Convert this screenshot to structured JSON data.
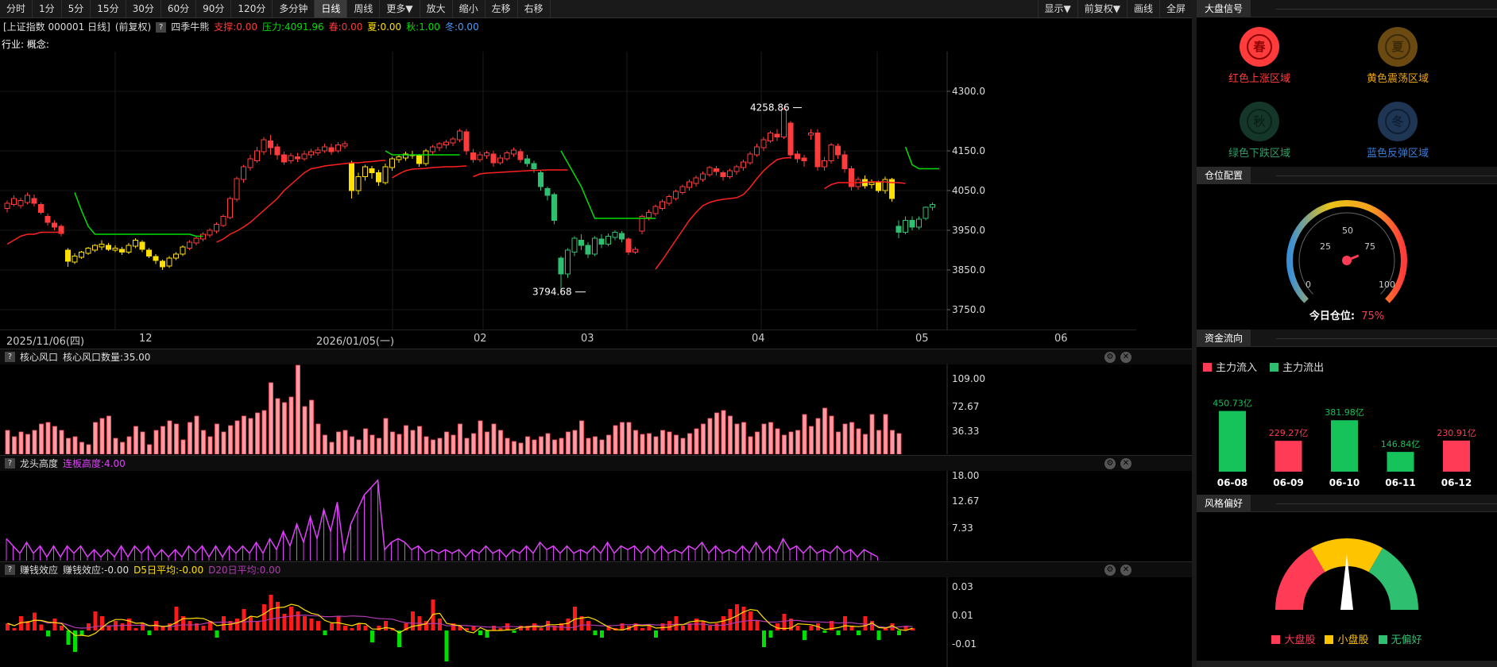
{
  "toolbar": {
    "left": [
      "分时",
      "1分",
      "5分",
      "15分",
      "30分",
      "60分",
      "90分",
      "120分",
      "多分钟",
      "日线",
      "周线",
      "更多▼",
      "放大",
      "缩小",
      "左移",
      "右移"
    ],
    "active_index": 9,
    "right": [
      "显示▼",
      "前复权▼",
      "画线",
      "全屏"
    ]
  },
  "main_info": {
    "index_name": "[上证指数 000001 日线]",
    "adjust": "(前复权)",
    "indicator": "四季牛熊",
    "support": "支撑:0.00",
    "pressure": "压力:4091.96",
    "spring": "春:0.00",
    "summer": "夏:0.00",
    "autumn": "秋:1.00",
    "winter": "冬:0.00",
    "industry": "行业: 概念:",
    "colors": {
      "support": "#ff3b3b",
      "pressure": "#00e000",
      "spring": "#ff3b3b",
      "summer": "#ffe000",
      "autumn": "#00e000",
      "winter": "#4a9cff"
    }
  },
  "main_chart": {
    "y_ticks": [
      "4300.0",
      "4150.0",
      "4050.0",
      "3950.0",
      "3850.0",
      "3750.0"
    ],
    "high_label": "4258.86",
    "low_label": "3794.68"
  },
  "date_axis": [
    "2025/11/06(四)",
    "12",
    "2026/01/05(一)",
    "02",
    "03",
    "04",
    "05",
    "06"
  ],
  "panel1": {
    "name": "核心风口",
    "value": "核心风口数量:35.00",
    "y_ticks": [
      "109.00",
      "72.67",
      "36.33"
    ]
  },
  "panel2": {
    "name": "龙头高度",
    "value": "连板高度:4.00",
    "y_ticks": [
      "18.00",
      "12.67",
      "7.33"
    ]
  },
  "panel3": {
    "name": "赚钱效应",
    "value": "赚钱效应:-0.00",
    "d5": "D5日平均:-0.00",
    "d20": "D20日平均:0.00",
    "y_ticks": [
      "0.03",
      "0.01",
      "-0.01"
    ]
  },
  "right": {
    "market_signal": {
      "title": "大盘信号",
      "seasons": [
        {
          "glyph": "春",
          "label": "红色上涨区域",
          "color": "#ff3b3b",
          "active": true
        },
        {
          "glyph": "夏",
          "label": "黄色震荡区域",
          "color": "#e8a317",
          "active": false
        },
        {
          "glyph": "秋",
          "label": "绿色下跌区域",
          "color": "#2f9c67",
          "active": false
        },
        {
          "glyph": "冬",
          "label": "蓝色反弹区域",
          "color": "#3a7bd5",
          "active": false
        }
      ]
    },
    "position": {
      "title": "仓位配置",
      "ticks": [
        "0",
        "25",
        "50",
        "75",
        "100"
      ],
      "label": "今日仓位:",
      "value": "75%",
      "level": 0.75
    },
    "capital_flow": {
      "title": "资金流向",
      "legend_in": "主力流入",
      "legend_out": "主力流出",
      "bars": [
        {
          "date": "06-08",
          "value": 450.73,
          "label": "450.73亿",
          "dir": "out"
        },
        {
          "date": "06-09",
          "value": 229.27,
          "label": "229.27亿",
          "dir": "in"
        },
        {
          "date": "06-10",
          "value": 381.98,
          "label": "381.98亿",
          "dir": "out"
        },
        {
          "date": "06-11",
          "value": 146.84,
          "label": "146.84亿",
          "dir": "out"
        },
        {
          "date": "06-12",
          "value": 230.91,
          "label": "230.91亿",
          "dir": "in"
        }
      ]
    },
    "style": {
      "title": "风格偏好",
      "legend": [
        {
          "label": "大盘股",
          "color": "#ff3b55"
        },
        {
          "label": "小盘股",
          "color": "#ffc400"
        },
        {
          "label": "无偏好",
          "color": "#2fbf71"
        }
      ]
    }
  },
  "chart_data": {
    "type": "candlestick",
    "title": "上证指数 000001 日线",
    "ylim": [
      3750,
      4300
    ],
    "candles": [
      [
        4005,
        4018,
        3995,
        4025
      ],
      [
        4015,
        4030,
        4010,
        4038
      ],
      [
        4012,
        4025,
        4005,
        4032
      ],
      [
        4020,
        4038,
        4015,
        4045
      ],
      [
        4030,
        4018,
        4010,
        4040
      ],
      [
        4015,
        3995,
        3990,
        4020
      ],
      [
        3985,
        3970,
        3962,
        3992
      ],
      [
        3968,
        3958,
        3950,
        3975
      ],
      [
        3960,
        3942,
        3935,
        3965
      ],
      [
        3900,
        3872,
        3858,
        3905
      ],
      [
        3870,
        3885,
        3865,
        3892
      ],
      [
        3882,
        3895,
        3878,
        3898
      ],
      [
        3892,
        3905,
        3888,
        3908
      ],
      [
        3900,
        3912,
        3895,
        3915
      ],
      [
        3908,
        3915,
        3900,
        3925
      ],
      [
        3912,
        3902,
        3898,
        3918
      ],
      [
        3900,
        3905,
        3895,
        3912
      ],
      [
        3902,
        3895,
        3888,
        3908
      ],
      [
        3895,
        3912,
        3890,
        3918
      ],
      [
        3910,
        3925,
        3905,
        3930
      ],
      [
        3920,
        3902,
        3895,
        3925
      ],
      [
        3900,
        3885,
        3880,
        3905
      ],
      [
        3884,
        3874,
        3865,
        3890
      ],
      [
        3872,
        3858,
        3850,
        3876
      ],
      [
        3860,
        3880,
        3855,
        3885
      ],
      [
        3880,
        3890,
        3875,
        3895
      ],
      [
        3890,
        3908,
        3885,
        3912
      ],
      [
        3905,
        3920,
        3900,
        3925
      ],
      [
        3918,
        3930,
        3912,
        3935
      ],
      [
        3928,
        3940,
        3922,
        3945
      ],
      [
        3938,
        3950,
        3932,
        3955
      ],
      [
        3948,
        3965,
        3942,
        3970
      ],
      [
        3962,
        3985,
        3958,
        3990
      ],
      [
        3982,
        4030,
        3978,
        4035
      ],
      [
        4028,
        4080,
        4022,
        4085
      ],
      [
        4078,
        4110,
        4070,
        4115
      ],
      [
        4108,
        4130,
        4100,
        4140
      ],
      [
        4125,
        4150,
        4120,
        4160
      ],
      [
        4148,
        4178,
        4140,
        4185
      ],
      [
        4175,
        4158,
        4140,
        4190
      ],
      [
        4160,
        4140,
        4128,
        4168
      ],
      [
        4140,
        4122,
        4115,
        4148
      ],
      [
        4125,
        4138,
        4118,
        4145
      ],
      [
        4135,
        4130,
        4122,
        4145
      ],
      [
        4130,
        4142,
        4125,
        4150
      ],
      [
        4140,
        4148,
        4132,
        4155
      ],
      [
        4145,
        4152,
        4138,
        4160
      ],
      [
        4150,
        4160,
        4145,
        4168
      ],
      [
        4158,
        4148,
        4140,
        4168
      ],
      [
        4150,
        4165,
        4145,
        4172
      ],
      [
        4162,
        4168,
        4155,
        4175
      ],
      [
        4120,
        4050,
        4030,
        4125
      ],
      [
        4050,
        4085,
        4040,
        4095
      ],
      [
        4085,
        4110,
        4075,
        4115
      ],
      [
        4105,
        4095,
        4080,
        4112
      ],
      [
        4095,
        4072,
        4062,
        4102
      ],
      [
        4070,
        4110,
        4065,
        4118
      ],
      [
        4108,
        4130,
        4100,
        4135
      ],
      [
        4128,
        4135,
        4120,
        4140
      ],
      [
        4132,
        4142,
        4125,
        4148
      ],
      [
        4140,
        4138,
        4130,
        4150
      ],
      [
        4138,
        4118,
        4110,
        4142
      ],
      [
        4118,
        4150,
        4112,
        4155
      ],
      [
        4148,
        4160,
        4140,
        4165
      ],
      [
        4158,
        4168,
        4150,
        4172
      ],
      [
        4165,
        4172,
        4155,
        4178
      ],
      [
        4170,
        4180,
        4162,
        4185
      ],
      [
        4178,
        4200,
        4172,
        4205
      ],
      [
        4198,
        4150,
        4140,
        4205
      ],
      [
        4145,
        4128,
        4120,
        4155
      ],
      [
        4128,
        4140,
        4122,
        4148
      ],
      [
        4138,
        4145,
        4130,
        4150
      ],
      [
        4142,
        4120,
        4110,
        4150
      ],
      [
        4120,
        4132,
        4115,
        4140
      ],
      [
        4130,
        4145,
        4125,
        4150
      ],
      [
        4142,
        4152,
        4135,
        4158
      ],
      [
        4148,
        4128,
        4120,
        4155
      ],
      [
        4130,
        4118,
        4110,
        4140
      ],
      [
        4118,
        4105,
        4095,
        4125
      ],
      [
        4095,
        4060,
        4050,
        4100
      ],
      [
        4055,
        4038,
        4025,
        4060
      ],
      [
        4040,
        3975,
        3965,
        4045
      ],
      [
        3880,
        3840,
        3794.68,
        3885
      ],
      [
        3840,
        3900,
        3830,
        3905
      ],
      [
        3895,
        3930,
        3885,
        3935
      ],
      [
        3925,
        3912,
        3900,
        3940
      ],
      [
        3912,
        3890,
        3880,
        3920
      ],
      [
        3890,
        3930,
        3885,
        3935
      ],
      [
        3928,
        3915,
        3905,
        3940
      ],
      [
        3915,
        3935,
        3910,
        3942
      ],
      [
        3932,
        3945,
        3925,
        3950
      ],
      [
        3942,
        3928,
        3920,
        3948
      ],
      [
        3928,
        3895,
        3888,
        3932
      ],
      [
        3895,
        3902,
        3890,
        3908
      ],
      [
        3948,
        3985,
        3940,
        3990
      ],
      [
        3982,
        3995,
        3975,
        4002
      ],
      [
        3992,
        4010,
        3985,
        4015
      ],
      [
        4005,
        4022,
        4000,
        4028
      ],
      [
        4018,
        4035,
        4012,
        4040
      ],
      [
        4030,
        4048,
        4025,
        4052
      ],
      [
        4045,
        4060,
        4040,
        4065
      ],
      [
        4058,
        4072,
        4050,
        4078
      ],
      [
        4068,
        4082,
        4060,
        4088
      ],
      [
        4078,
        4092,
        4072,
        4098
      ],
      [
        4090,
        4108,
        4085,
        4112
      ],
      [
        4105,
        4098,
        4088,
        4112
      ],
      [
        4095,
        4085,
        4075,
        4100
      ],
      [
        4085,
        4100,
        4080,
        4105
      ],
      [
        4098,
        4110,
        4090,
        4115
      ],
      [
        4108,
        4122,
        4100,
        4128
      ],
      [
        4120,
        4142,
        4115,
        4148
      ],
      [
        4140,
        4160,
        4135,
        4168
      ],
      [
        4158,
        4178,
        4150,
        4185
      ],
      [
        4175,
        4195,
        4170,
        4200
      ],
      [
        4192,
        4185,
        4175,
        4205
      ],
      [
        4185,
        4255,
        4180,
        4258.86
      ],
      [
        4220,
        4140,
        4130,
        4225
      ],
      [
        4142,
        4130,
        4120,
        4150
      ],
      [
        4132,
        4125,
        4110,
        4140
      ],
      [
        4190,
        4195,
        4178,
        4205
      ],
      [
        4195,
        4110,
        4100,
        4205
      ],
      [
        4110,
        4125,
        4100,
        4135
      ],
      [
        4125,
        4165,
        4118,
        4170
      ],
      [
        4162,
        4140,
        4130,
        4168
      ],
      [
        4140,
        4105,
        4095,
        4150
      ],
      [
        4105,
        4060,
        4050,
        4112
      ],
      [
        4060,
        4078,
        4052,
        4085
      ],
      [
        4078,
        4062,
        4055,
        4088
      ],
      [
        4065,
        4070,
        4055,
        4078
      ],
      [
        4070,
        4050,
        4045,
        4075
      ],
      [
        4050,
        4078,
        4042,
        4085
      ],
      [
        4078,
        4030,
        4022,
        4082
      ],
      [
        3960,
        3945,
        3930,
        3975
      ],
      [
        3945,
        3975,
        3940,
        3985
      ],
      [
        3975,
        3958,
        3950,
        3985
      ],
      [
        3958,
        3978,
        3952,
        3985
      ],
      [
        3980,
        4008,
        3975,
        4010
      ],
      [
        4008,
        4015,
        4000,
        4020
      ]
    ],
    "pressure_line": [
      [
        3915,
        3925,
        3935,
        3940,
        3940,
        3945,
        3945,
        3945,
        3945
      ],
      [
        3920,
        3928,
        3940,
        3948,
        3958,
        3970,
        3985,
        4000,
        4015,
        4030,
        4050,
        4065,
        4080,
        4095,
        4105,
        4108,
        4112,
        4114,
        4116,
        4118,
        4120,
        4120,
        4122,
        4123,
        4125,
        4126
      ],
      [
        4082,
        4092,
        4100,
        4104,
        4105,
        4106,
        4108,
        4109,
        4110,
        4110,
        4111,
        4112
      ],
      [
        4085,
        4092,
        4094,
        4095,
        4096,
        4097,
        4098,
        4099,
        4100,
        4101,
        4101,
        4102,
        4102,
        4102,
        4102
      ],
      [
        3852,
        3875,
        3900,
        3925,
        3950,
        3975,
        3995,
        4012,
        4020,
        4025,
        4028,
        4030,
        4032,
        4040,
        4058,
        4080,
        4100,
        4115,
        4128,
        4132,
        4133
      ],
      [
        4055,
        4065,
        4070,
        4070,
        4070,
        4070,
        4071,
        4072,
        4072,
        4072,
        4070,
        4070,
        4068
      ]
    ]
  }
}
